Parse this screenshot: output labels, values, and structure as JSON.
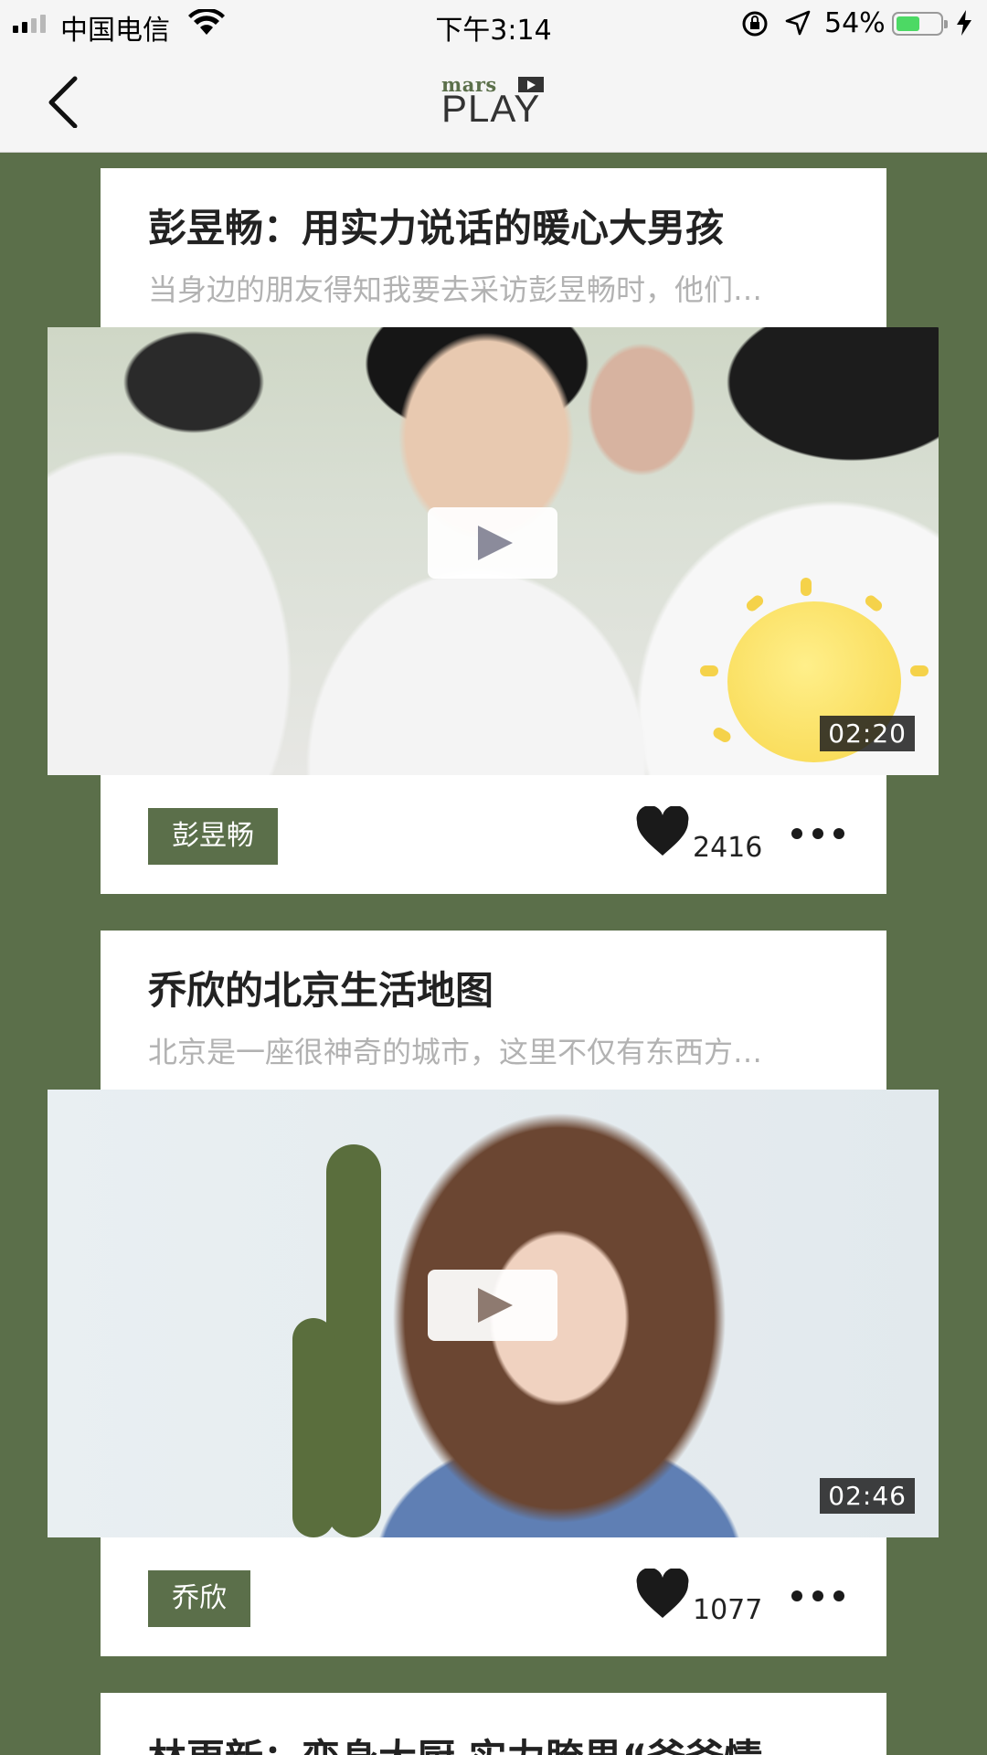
{
  "status_bar": {
    "carrier": "中国电信",
    "time": "下午3:14",
    "battery_percent": "54%",
    "battery_level": 0.54
  },
  "nav": {
    "logo_top": "mars",
    "logo_bottom": "PLAY"
  },
  "cards": [
    {
      "title": "彭昱畅：用实力说话的暖心大男孩",
      "summary": "当身边的朋友得知我要去采访彭昱畅时，他们…",
      "duration": "02:20",
      "tag": "彭昱畅",
      "likes": "2416"
    },
    {
      "title": "乔欣的北京生活地图",
      "summary": "北京是一座很神奇的城市，这里不仅有东西方…",
      "duration": "02:46",
      "tag": "乔欣",
      "likes": "1077"
    },
    {
      "title": "林更新：变身大厨 实力胯界“爸爸情"
    }
  ],
  "colors": {
    "brand_green": "#5b6f4a",
    "bar_bg": "#f5f5f5",
    "battery_green": "#4cd964"
  }
}
